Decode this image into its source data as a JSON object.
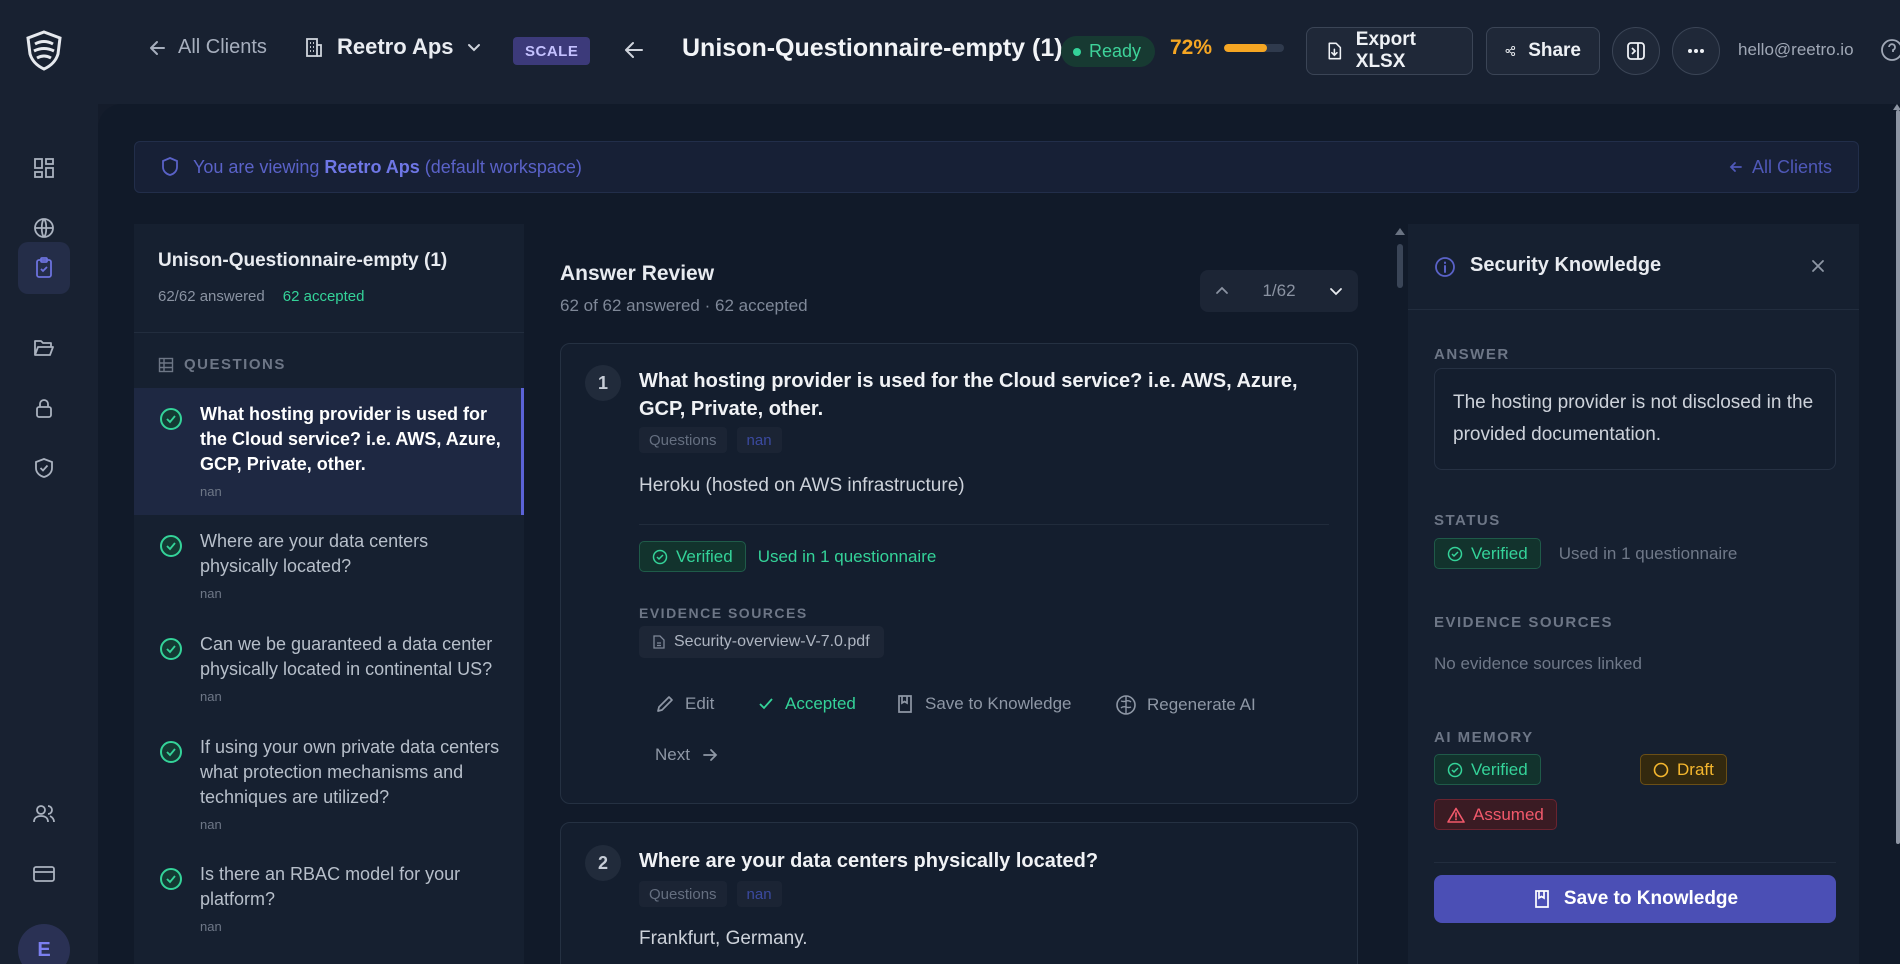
{
  "header": {
    "back_label": "All Clients",
    "workspace": "Reetro Aps",
    "plan_badge": "SCALE",
    "title": "Unison-Questionnaire-empty (1)",
    "status": "Ready",
    "progress_pct": 0.72,
    "progress_label": "72%",
    "export_label": "Export XLSX",
    "share_label": "Share",
    "user_email": "hello@reetro.io"
  },
  "sidebar_nav": {
    "items": [
      "dashboard-icon",
      "globe-icon",
      "clipboard-check-icon",
      "folder-open-icon",
      "lock-icon",
      "shield-check-icon",
      "users-icon",
      "credit-card-icon"
    ],
    "active": "clipboard-check-icon",
    "avatar_initial": "E"
  },
  "notice": {
    "prefix": "You are viewing",
    "workspace": "Reetro Aps",
    "suffix": "(default workspace)",
    "back_label": "All Clients"
  },
  "question_panel": {
    "title": "Unison-Questionnaire-empty (1)",
    "answered": "62/62 answered",
    "accepted": "62 accepted",
    "section_label": "QUESTIONS",
    "items": [
      {
        "text": "What hosting provider is used for the Cloud service? i.e. AWS, Azure, GCP, Private, other.",
        "sub": "nan"
      },
      {
        "text": "Where are your data centers physically located?",
        "sub": "nan"
      },
      {
        "text": "Can we be guaranteed a data center physically located in continental US?",
        "sub": "nan"
      },
      {
        "text": "If using your own private data centers what protection mechanisms and techniques are utilized?",
        "sub": "nan"
      },
      {
        "text": "Is there an RBAC model for your platform?",
        "sub": "nan"
      }
    ]
  },
  "review": {
    "title": "Answer Review",
    "subtitle": "62 of 62 answered · 62 accepted",
    "pager": "1/62",
    "cards": [
      {
        "num": "1",
        "question": "What hosting provider is used for the Cloud service? i.e. AWS, Azure, GCP, Private, other.",
        "tags": [
          "Questions",
          "nan"
        ],
        "answer": "Heroku (hosted on AWS infrastructure)",
        "verified_label": "Verified",
        "used_label": "Used in 1 questionnaire",
        "evidence_label": "EVIDENCE SOURCES",
        "evidence_file": "Security-overview-V-7.0.pdf",
        "actions": {
          "edit": "Edit",
          "accepted": "Accepted",
          "save": "Save to Knowledge",
          "regen": "Regenerate AI",
          "next": "Next"
        }
      },
      {
        "num": "2",
        "question": "Where are your data centers physically located?",
        "tags": [
          "Questions",
          "nan"
        ],
        "answer": "Frankfurt, Germany."
      }
    ]
  },
  "knowledge_panel": {
    "title": "Security Knowledge",
    "answer_label": "ANSWER",
    "answer": "The hosting provider is not disclosed in the provided documentation.",
    "status_label": "STATUS",
    "status": "Verified",
    "used": "Used in 1 questionnaire",
    "evidence_label": "EVIDENCE SOURCES",
    "evidence_empty": "No evidence sources linked",
    "memory_label": "AI MEMORY",
    "memory": {
      "verified": "Verified",
      "draft": "Draft",
      "assumed": "Assumed"
    },
    "save_label": "Save to Knowledge"
  },
  "colors": {
    "accent": "#4b4fb5",
    "success": "#34d399",
    "warning": "#f5a623",
    "danger": "#f2596b"
  }
}
